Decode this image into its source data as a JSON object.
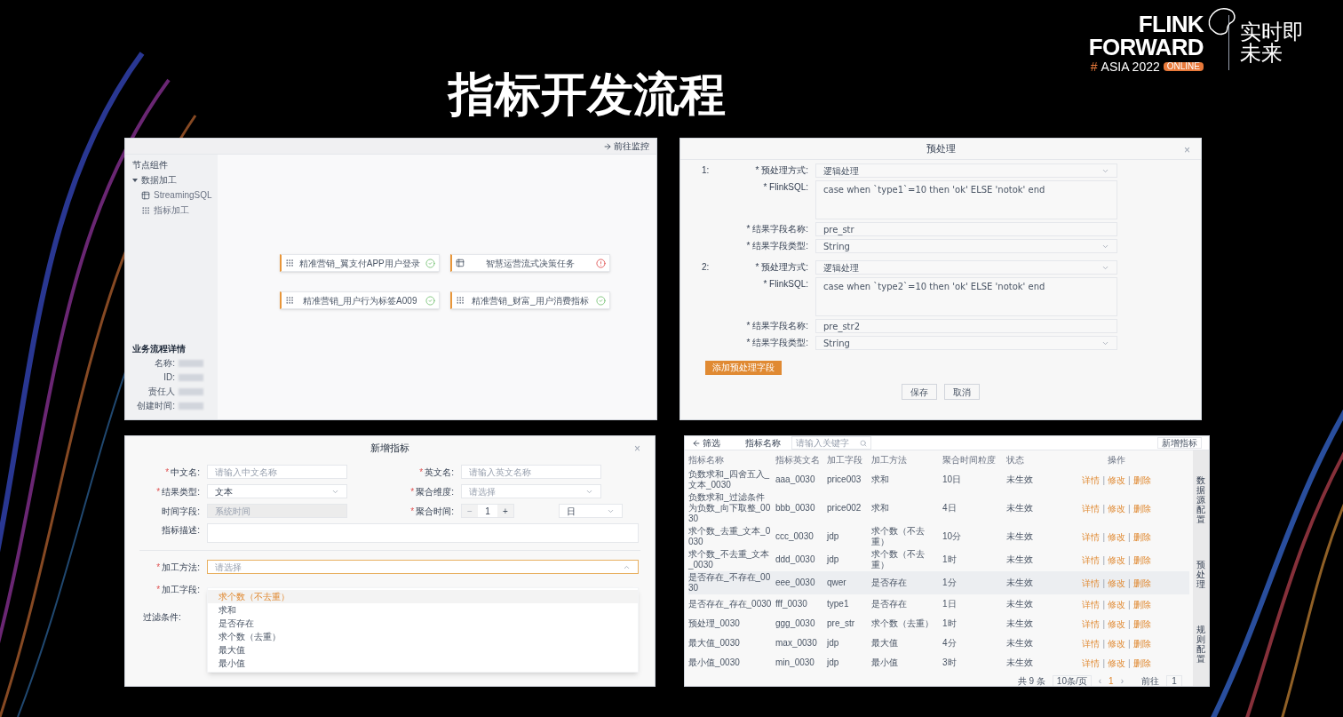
{
  "slide": {
    "title": "指标开发流程"
  },
  "logo": {
    "line1": "FLINK",
    "line2": "FORWARD",
    "hash": "#",
    "event": "ASIA 2022",
    "badge": "ONLINE",
    "slogan_line1": "实时即",
    "slogan_line2": "未来"
  },
  "flow_editor": {
    "header_action": "前往监控",
    "sidebar_title": "节点组件",
    "tree": [
      {
        "label": "数据加工",
        "expanded": true,
        "children": [
          {
            "label": "StreamingSQL",
            "kind": "sql"
          },
          {
            "label": "指标加工",
            "kind": "indicator"
          }
        ]
      }
    ],
    "details_title": "业务流程详情",
    "details_labels": [
      "名称:",
      "ID:",
      "责任人",
      "创建时间:"
    ],
    "nodes": [
      {
        "label": "精准营销_翼支付APP用户登录",
        "kind": "indicator",
        "valid": true
      },
      {
        "label": "智慧运营流式决策任务",
        "kind": "sql",
        "valid": false
      },
      {
        "label": "精准营销_用户行为标签A009",
        "kind": "indicator",
        "valid": true
      },
      {
        "label": "精准营销_财富_用户消费指标",
        "kind": "indicator",
        "valid": true
      }
    ]
  },
  "preprocess_dialog": {
    "title": "预处理",
    "close": "×",
    "groups": [
      {
        "index": "1:",
        "fields": [
          {
            "label": "* 预处理方式:",
            "kind": "select",
            "value": "逻辑处理"
          },
          {
            "label": "* FlinkSQL:",
            "kind": "textarea",
            "value": "case when `type1`=10 then 'ok' ELSE 'notok' end"
          },
          {
            "label": "* 结果字段名称:",
            "kind": "input",
            "value": "pre_str"
          },
          {
            "label": "* 结果字段类型:",
            "kind": "select",
            "value": "String"
          }
        ]
      },
      {
        "index": "2:",
        "fields": [
          {
            "label": "* 预处理方式:",
            "kind": "select",
            "value": "逻辑处理"
          },
          {
            "label": "* FlinkSQL:",
            "kind": "textarea",
            "value": "case when `type2`=10 then 'ok' ELSE 'notok' end"
          },
          {
            "label": "* 结果字段名称:",
            "kind": "input",
            "value": "pre_str2"
          },
          {
            "label": "* 结果字段类型:",
            "kind": "select",
            "value": "String"
          }
        ]
      }
    ],
    "add_button": "添加预处理字段",
    "buttons": [
      "保存",
      "取消"
    ]
  },
  "new_indicator_dialog": {
    "title": "新增指标",
    "close": "×",
    "rows": [
      [
        {
          "mark": "*",
          "label": "中文名:",
          "kind": "input",
          "placeholder": "请输入中文名称"
        },
        {
          "mark": "*",
          "label": "英文名:",
          "kind": "input",
          "placeholder": "请输入英文名称"
        }
      ],
      [
        {
          "mark": "*",
          "label": "结果类型:",
          "kind": "select",
          "value": "文本"
        },
        {
          "mark": "*",
          "label": "聚合维度:",
          "kind": "select",
          "placeholder": "请选择"
        }
      ],
      [
        {
          "label": "时间字段:",
          "kind": "input",
          "placeholder": "系统时间",
          "disabled": true
        },
        {
          "mark": "*",
          "label": "聚合时间:",
          "kind": "stepper",
          "minus": "−",
          "value": "1",
          "plus": "+",
          "unit": "日"
        }
      ]
    ],
    "description_label": "指标描述:",
    "method": {
      "mark": "*",
      "label": "加工方法:",
      "placeholder": "请选择",
      "expanded": true,
      "options": [
        {
          "label": "求个数（不去重）",
          "selected": true
        },
        {
          "label": "求和",
          "selected": false
        },
        {
          "label": "是否存在",
          "selected": false
        },
        {
          "label": "求个数（去重）",
          "selected": false
        },
        {
          "label": "最大值",
          "selected": false
        },
        {
          "label": "最小值",
          "selected": false
        }
      ]
    },
    "field": {
      "mark": "*",
      "label": "加工字段:"
    },
    "filter_label": "过滤条件:"
  },
  "indicator_list": {
    "back": "筛选",
    "search_label": "指标名称",
    "search_placeholder": "请输入关键字",
    "new_button": "新增指标",
    "columns": [
      "指标名称",
      "指标英文名",
      "加工字段",
      "加工方法",
      "聚合时间粒度",
      "状态",
      "操作"
    ],
    "rows": [
      {
        "cells": [
          "负数求和_四舍五入_文本_0030",
          "aaa_0030",
          "price003",
          "求和",
          "10日",
          "未生效"
        ],
        "highlighted": false,
        "actions": [
          "详情",
          "修改",
          "删除"
        ],
        "separators": [
          "|",
          "|"
        ]
      },
      {
        "cells": [
          "负数求和_过滤条件为负数_向下取整_0030",
          "bbb_0030",
          "price002",
          "求和",
          "4日",
          "未生效"
        ],
        "highlighted": false,
        "actions": [
          "详情",
          "修改",
          "删除"
        ],
        "separators": [
          "|",
          "|"
        ]
      },
      {
        "cells": [
          "求个数_去重_文本_0030",
          "ccc_0030",
          "jdp",
          "求个数（不去重）",
          "10分",
          "未生效"
        ],
        "highlighted": false,
        "actions": [
          "详情",
          "修改",
          "删除"
        ],
        "separators": [
          "|",
          "|"
        ]
      },
      {
        "cells": [
          "求个数_不去重_文本_0030",
          "ddd_0030",
          "jdp",
          "求个数（不去重）",
          "1时",
          "未生效"
        ],
        "highlighted": false,
        "actions": [
          "详情",
          "修改",
          "删除"
        ],
        "separators": [
          "|",
          "|"
        ]
      },
      {
        "cells": [
          "是否存在_不存在_0030",
          "eee_0030",
          "qwer",
          "是否存在",
          "1分",
          "未生效"
        ],
        "highlighted": true,
        "actions": [
          "详情",
          "修改",
          "删除"
        ],
        "separators": [
          "|",
          "|"
        ]
      },
      {
        "cells": [
          "是否存在_存在_0030",
          "fff_0030",
          "type1",
          "是否存在",
          "1日",
          "未生效"
        ],
        "highlighted": false,
        "actions": [
          "详情",
          "修改",
          "删除"
        ],
        "separators": [
          "|",
          "|"
        ]
      },
      {
        "cells": [
          "预处理_0030",
          "ggg_0030",
          "pre_str",
          "求个数（去重）",
          "1时",
          "未生效"
        ],
        "highlighted": false,
        "actions": [
          "详情",
          "修改",
          "删除"
        ],
        "separators": [
          "|",
          "|"
        ]
      },
      {
        "cells": [
          "最大值_0030",
          "max_0030",
          "jdp",
          "最大值",
          "4分",
          "未生效"
        ],
        "highlighted": false,
        "actions": [
          "详情",
          "修改",
          "删除"
        ],
        "separators": [
          "|",
          "|"
        ]
      },
      {
        "cells": [
          "最小值_0030",
          "min_0030",
          "jdp",
          "最小值",
          "3时",
          "未生效"
        ],
        "highlighted": false,
        "actions": [
          "详情",
          "修改",
          "删除"
        ],
        "separators": [
          "|",
          "|"
        ]
      }
    ],
    "side_tabs": [
      "数据源配置",
      "预处理",
      "规则配置"
    ],
    "pagination": {
      "total": "共 9 条",
      "page_size": "10条/页",
      "prev": "‹",
      "page": "1",
      "next": "›",
      "goto": "前往",
      "goto_value": "1"
    }
  }
}
